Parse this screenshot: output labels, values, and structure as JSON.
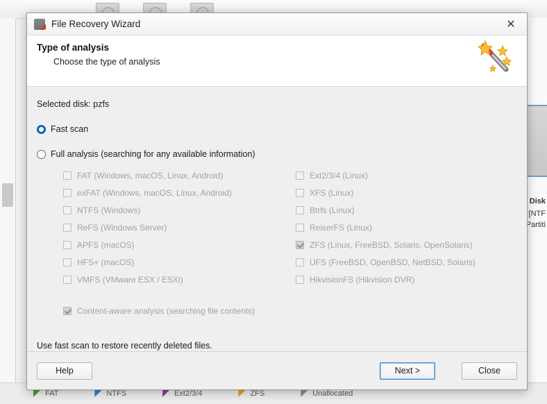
{
  "background": {
    "toolbar_icons": [
      "disk-icon",
      "disk-icon",
      "disk-icon"
    ],
    "right_panel": {
      "line1": "al Disk",
      "line2": "B [NTF",
      "line3": "Partiti"
    },
    "legend": [
      {
        "label": "FAT",
        "color": "#4e9a2f"
      },
      {
        "label": "NTFS",
        "color": "#2f7fd4"
      },
      {
        "label": "Ext2/3/4",
        "color": "#8a3fa0"
      },
      {
        "label": "ZFS",
        "color": "#e0a61b"
      },
      {
        "label": "Unallocated",
        "color": "#8f8f8f"
      }
    ]
  },
  "dialog": {
    "title": "File Recovery Wizard",
    "close_label": "✕",
    "header": {
      "title": "Type of analysis",
      "subtitle": "Choose the type of analysis",
      "icon": "magic-wand-icon"
    },
    "selected_disk": "Selected disk: pzfs",
    "scan_modes": [
      {
        "label": "Fast scan",
        "selected": true
      },
      {
        "label": "Full analysis (searching for any available information)",
        "selected": false
      }
    ],
    "filesystems_left": [
      {
        "label": "FAT (Windows, macOS, Linux, Android)",
        "checked": false
      },
      {
        "label": "exFAT (Windows, macOS, Linux, Android)",
        "checked": false
      },
      {
        "label": "NTFS (Windows)",
        "checked": false
      },
      {
        "label": "ReFS (Windows Server)",
        "checked": false
      },
      {
        "label": "APFS (macOS)",
        "checked": false
      },
      {
        "label": "HFS+ (macOS)",
        "checked": false
      },
      {
        "label": "VMFS (VMware ESX / ESXi)",
        "checked": false
      }
    ],
    "filesystems_right": [
      {
        "label": "Ext2/3/4 (Linux)",
        "checked": false
      },
      {
        "label": "XFS (Linux)",
        "checked": false
      },
      {
        "label": "Btrfs (Linux)",
        "checked": false
      },
      {
        "label": "ReiserFS (Linux)",
        "checked": false
      },
      {
        "label": "ZFS (Linux, FreeBSD, Solaris, OpenSolaris)",
        "checked": true
      },
      {
        "label": "UFS (FreeBSD, OpenBSD, NetBSD, Solaris)",
        "checked": false
      },
      {
        "label": "HikvisionFS (Hikvision DVR)",
        "checked": false
      }
    ],
    "content_aware": {
      "label": "Content-aware analysis (searching file contents)",
      "checked": true
    },
    "hint": "Use fast scan to restore recently deleted files.",
    "buttons": {
      "help": "Help",
      "next": "Next >",
      "close": "Close"
    }
  }
}
